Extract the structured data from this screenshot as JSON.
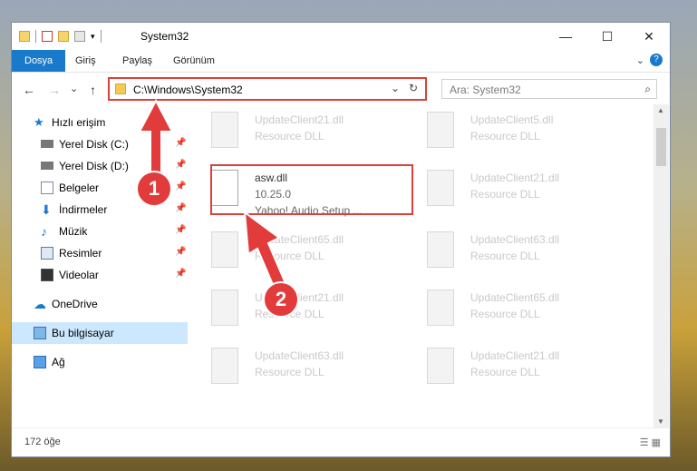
{
  "window": {
    "title": "System32",
    "controls": {
      "minimize": "—",
      "maximize": "☐",
      "close": "✕"
    }
  },
  "ribbon": {
    "tabs": [
      "Dosya",
      "Giriş",
      "Paylaş",
      "Görünüm"
    ]
  },
  "address": {
    "path": "C:\\Windows\\System32",
    "search_placeholder": "Ara: System32"
  },
  "sidebar": {
    "items": [
      {
        "label": "Hızlı erişim",
        "icon": "star-icon"
      },
      {
        "label": "Yerel Disk (C:)",
        "icon": "drive-icon"
      },
      {
        "label": "Yerel Disk (D:)",
        "icon": "drive-icon"
      },
      {
        "label": "Belgeler",
        "icon": "documents-icon"
      },
      {
        "label": "İndirmeler",
        "icon": "downloads-icon"
      },
      {
        "label": "Müzik",
        "icon": "music-icon"
      },
      {
        "label": "Resimler",
        "icon": "pictures-icon"
      },
      {
        "label": "Videolar",
        "icon": "videos-icon"
      },
      {
        "label": "OneDrive",
        "icon": "cloud-icon"
      },
      {
        "label": "Bu bilgisayar",
        "icon": "computer-icon"
      },
      {
        "label": "Ağ",
        "icon": "network-icon"
      }
    ]
  },
  "files": [
    {
      "name": "UpdateClient21.dll",
      "desc": "Resource DLL"
    },
    {
      "name": "UpdateClient5.dll",
      "desc": "Resource DLL"
    },
    {
      "name": "asw.dll",
      "version": "10.25.0",
      "desc": "Yahoo! Audio Setup ..."
    },
    {
      "name": "UpdateClient21.dll",
      "desc": "Resource DLL"
    },
    {
      "name": "UpdateClient65.dll",
      "desc": "Resource DLL"
    },
    {
      "name": "UpdateClient63.dll",
      "desc": "Resource DLL"
    },
    {
      "name": "UpdateClient21.dll",
      "desc": "Resource DLL"
    },
    {
      "name": "UpdateClient65.dll",
      "desc": "Resource DLL"
    },
    {
      "name": "UpdateClient63.dll",
      "desc": "Resource DLL"
    },
    {
      "name": "UpdateClient21.dll",
      "desc": "Resource DLL"
    }
  ],
  "status": {
    "count": "172 öğe"
  },
  "annotations": {
    "badge1": "1",
    "badge2": "2"
  },
  "colors": {
    "accent": "#1979ca",
    "highlight": "#d9413a"
  }
}
